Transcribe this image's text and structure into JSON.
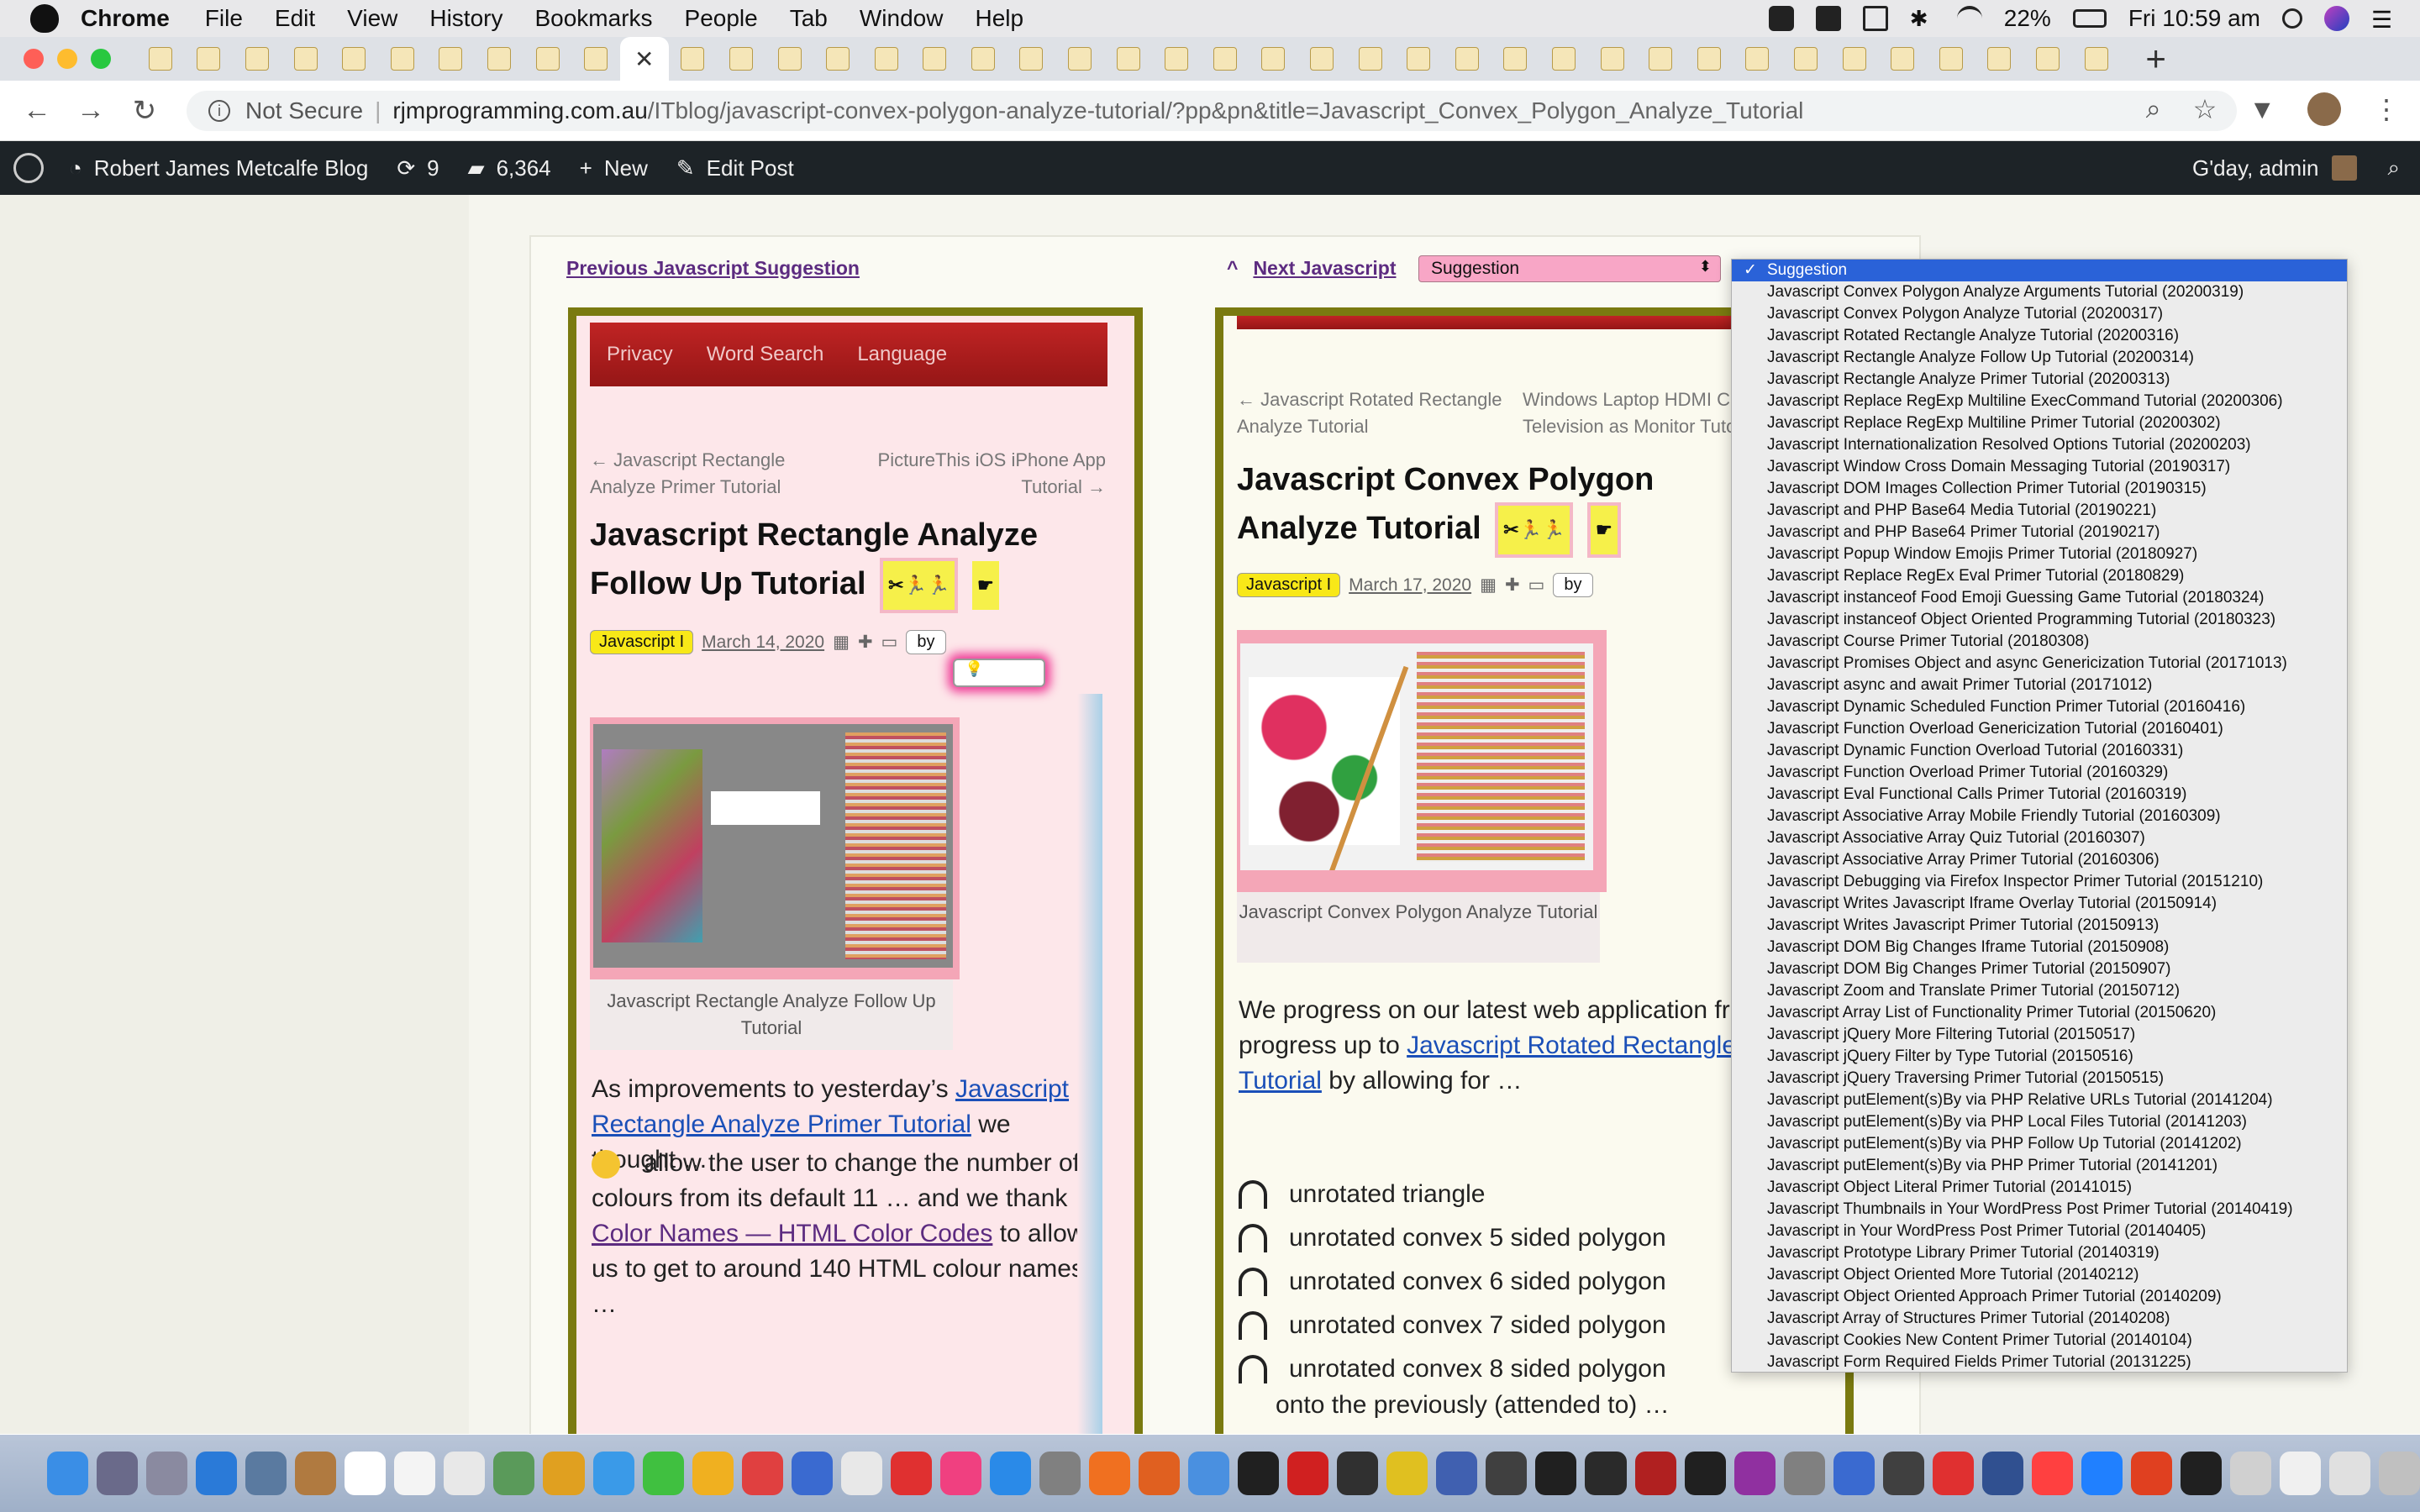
{
  "menubar": {
    "app_name": "Chrome",
    "items": [
      "File",
      "Edit",
      "View",
      "History",
      "Bookmarks",
      "People",
      "Tab",
      "Window",
      "Help"
    ],
    "battery": "22%",
    "clock": "Fri 10:59 am"
  },
  "browser": {
    "tab_close_glyph": "✕",
    "new_tab_glyph": "+",
    "security_label": "Not Secure",
    "url_domain": "rjmprogramming.com.au",
    "url_path": "/ITblog/javascript-convex-polygon-analyze-tutorial/?pp&pn&title=Javascript_Convex_Polygon_Analyze_Tutorial"
  },
  "wpbar": {
    "site_name": "Robert James Metcalfe Blog",
    "updates_count": "9",
    "comments_count": "6,364",
    "new_label": "New",
    "edit_label": "Edit Post",
    "greeting": "G'day, admin"
  },
  "nav": {
    "prev_label": "Previous Javascript Suggestion",
    "next_caret": "^",
    "next_label": "Next Javascript",
    "select_value": "Suggestion"
  },
  "left_post": {
    "menu": [
      "Privacy",
      "Word Search",
      "Language"
    ],
    "prev_post": "← Javascript Rectangle Analyze Primer Tutorial",
    "next_post": "PictureThis iOS iPhone App Tutorial →",
    "title": "Javascript Rectangle Analyze Follow Up Tutorial",
    "category_select": "Javascript I",
    "date": "March 14, 2020",
    "by_select": "by",
    "caption": "Javascript Rectangle Analyze Follow Up Tutorial",
    "para_intro": "As improvements to yesterday’s",
    "para_link": "Javascript Rectangle Analyze Primer Tutorial",
    "para_tail": " we thought …",
    "bullet_text": "allow the user to change the number of colours from its default 11 … and we thank",
    "bullet_link": "Color Names — HTML Color Codes",
    "bullet_tail": " to allow us to get to around 140 HTML colour names …"
  },
  "right_post": {
    "prev_post": "← Javascript Rotated Rectangle Analyze Tutorial",
    "next_post": "Windows Laptop HDMI Cable Television as Monitor Tutorial →",
    "title": "Javascript Convex Polygon Analyze Tutorial",
    "category_select": "Javascript I",
    "date": "March 17, 2020",
    "by_select": "by",
    "caption": "Javascript Convex Polygon Analyze Tutorial",
    "para_intro": "We progress on our latest web application from the progress up to",
    "para_link": "Javascript Rotated Rectangle Analyze Tutorial",
    "para_tail": " by allowing for …",
    "bullets": [
      "unrotated triangle",
      "unrotated convex 5 sided polygon",
      "unrotated convex 6 sided polygon",
      "unrotated convex 7 sided polygon",
      "unrotated convex 8 sided polygon"
    ],
    "bullet_tail": "onto the previously (attended to) …"
  },
  "dropdown": {
    "selected": "Suggestion",
    "options": [
      "Javascript Convex Polygon Analyze Arguments Tutorial (20200319)",
      "Javascript Convex Polygon Analyze Tutorial (20200317)",
      "Javascript Rotated Rectangle Analyze Tutorial (20200316)",
      "Javascript Rectangle Analyze Follow Up Tutorial (20200314)",
      "Javascript Rectangle Analyze Primer Tutorial (20200313)",
      "Javascript Replace RegExp Multiline ExecCommand Tutorial (20200306)",
      "Javascript Replace RegExp Multiline Primer Tutorial (20200302)",
      "Javascript Internationalization Resolved Options Tutorial (20200203)",
      "Javascript Window Cross Domain Messaging Tutorial (20190317)",
      "Javascript DOM Images Collection Primer Tutorial (20190315)",
      "Javascript and PHP Base64 Media Tutorial (20190221)",
      "Javascript and PHP Base64 Primer Tutorial (20190217)",
      "Javascript Popup Window Emojis Primer Tutorial (20180927)",
      "Javascript Replace RegEx Eval Primer Tutorial (20180829)",
      "Javascript instanceof Food Emoji Guessing Game Tutorial (20180324)",
      "Javascript instanceof Object Oriented Programming Tutorial (20180323)",
      "Javascript Course Primer Tutorial (20180308)",
      "Javascript Promises Object and async Genericization Tutorial (20171013)",
      "Javascript async and await Primer Tutorial (20171012)",
      "Javascript Dynamic Scheduled Function Primer Tutorial (20160416)",
      "Javascript Function Overload Genericization Tutorial (20160401)",
      "Javascript Dynamic Function Overload Tutorial (20160331)",
      "Javascript Function Overload Primer Tutorial (20160329)",
      "Javascript Eval Functional Calls Primer Tutorial (20160319)",
      "Javascript Associative Array Mobile Friendly Tutorial (20160309)",
      "Javascript Associative Array Quiz Tutorial (20160307)",
      "Javascript Associative Array Primer Tutorial (20160306)",
      "Javascript Debugging via Firefox Inspector Primer Tutorial (20151210)",
      "Javascript Writes Javascript Iframe Overlay Tutorial (20150914)",
      "Javascript Writes Javascript Primer Tutorial (20150913)",
      "Javascript DOM Big Changes Iframe Tutorial (20150908)",
      "Javascript DOM Big Changes Primer Tutorial (20150907)",
      "Javascript Zoom and Translate Primer Tutorial (20150712)",
      "Javascript Array List of Functionality Primer Tutorial (20150620)",
      "Javascript jQuery More Filtering Tutorial (20150517)",
      "Javascript jQuery Filter by Type Tutorial (20150516)",
      "Javascript jQuery Traversing Primer Tutorial (20150515)",
      "Javascript putElement(s)By via PHP Relative URLs Tutorial (20141204)",
      "Javascript putElement(s)By via PHP Local Files Tutorial (20141203)",
      "Javascript putElement(s)By via PHP Follow Up Tutorial (20141202)",
      "Javascript putElement(s)By via PHP Primer Tutorial (20141201)",
      "Javascript Object Literal Primer Tutorial (20141015)",
      "Javascript Thumbnails in Your WordPress Post Primer Tutorial (20140419)",
      "Javascript in Your WordPress Post Primer Tutorial (20140405)",
      "Javascript Prototype Library Primer Tutorial (20140319)",
      "Javascript Object Oriented More Tutorial (20140212)",
      "Javascript Object Oriented Approach Primer Tutorial (20140209)",
      "Javascript Array of Structures Primer Tutorial (20140208)",
      "Javascript Cookies New Content Primer Tutorial (20140104)",
      "Javascript Form Required Fields Primer Tutorial (20131225)"
    ]
  },
  "colors": {
    "wp_bar": "#1d2327",
    "frame_border": "#7a7a10",
    "dropdown_selected": "#2a62d8",
    "select_pink": "#f8a6c6",
    "red_menu": "#c02424"
  }
}
